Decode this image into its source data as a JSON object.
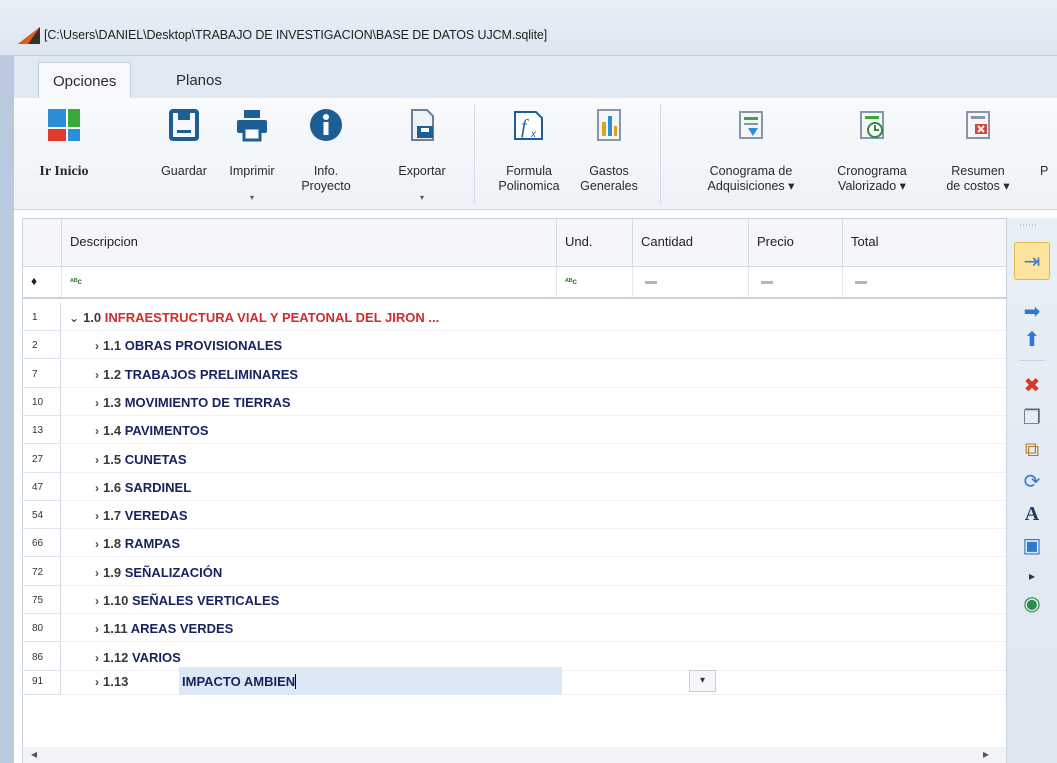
{
  "window": {
    "title": "[C:\\Users\\DANIEL\\Desktop\\TRABAJO DE INVESTIGACION\\BASE DE DATOS UJCM.sqlite]"
  },
  "ribbon_tabs": [
    {
      "label": "Opciones",
      "active": true
    },
    {
      "label": "Planos",
      "active": false
    }
  ],
  "ribbon": {
    "ir_inicio": "Ir Inicio",
    "guardar": "Guardar",
    "imprimir": "Imprimir",
    "info_line1": "Info.",
    "info_line2": "Proyecto",
    "exportar": "Exportar",
    "formula_line1": "Formula",
    "formula_line2": "Polinomica",
    "gastos_line1": "Gastos",
    "gastos_line2": "Generales",
    "conograma_line1": "Conograma de",
    "conograma_line2": "Adquisiciones ▾",
    "cronograma_line1": "Cronograma",
    "cronograma_line2": "Valorizado ▾",
    "resumen_line1": "Resumen",
    "resumen_line2": "de costos ▾",
    "cutoff": "P",
    "dropdown_glyph": "▾"
  },
  "grid": {
    "columns": [
      "Descripcion",
      "Und.",
      "Cantidad",
      "Precio",
      "Total"
    ],
    "filter_pin": "♦",
    "filter_text_glyph": "ᴬᴮc",
    "rows": [
      {
        "num": "1",
        "arrow": "⌄",
        "code": "1.0",
        "title": "INFRAESTRUCTURA VIAL Y PEATONAL DEL JIRON ..."
      },
      {
        "num": "2",
        "arrow": "›",
        "code": "1.1",
        "title": "OBRAS PROVISIONALES"
      },
      {
        "num": "7",
        "arrow": "›",
        "code": "1.2",
        "title": "TRABAJOS PRELIMINARES"
      },
      {
        "num": "10",
        "arrow": "›",
        "code": "1.3",
        "title": "MOVIMIENTO DE TIERRAS"
      },
      {
        "num": "13",
        "arrow": "›",
        "code": "1.4",
        "title": "PAVIMENTOS"
      },
      {
        "num": "27",
        "arrow": "›",
        "code": "1.5",
        "title": "CUNETAS"
      },
      {
        "num": "47",
        "arrow": "›",
        "code": "1.6",
        "title": "SARDINEL"
      },
      {
        "num": "54",
        "arrow": "›",
        "code": "1.7",
        "title": "VEREDAS"
      },
      {
        "num": "66",
        "arrow": "›",
        "code": "1.8",
        "title": "RAMPAS"
      },
      {
        "num": "72",
        "arrow": "›",
        "code": "1.9",
        "title": "SEÑALIZACIÓN"
      },
      {
        "num": "75",
        "arrow": "›",
        "code": "1.10",
        "title": "SEÑALES VERTICALES"
      },
      {
        "num": "80",
        "arrow": "›",
        "code": "1.11",
        "title": "AREAS VERDES"
      },
      {
        "num": "86",
        "arrow": "›",
        "code": "1.12",
        "title": "VARIOS"
      }
    ],
    "edit_row": {
      "num": "91",
      "arrow": "›",
      "code": "1.13",
      "value": "IMPACTO AMBIEN",
      "dropdown": "▾"
    },
    "scroll_left": "◂",
    "scroll_right": "▸"
  },
  "sidebar": {
    "grip": "⋯⋯",
    "icons": [
      "⇥",
      "➡",
      "⬆",
      "✖",
      "❐",
      "⧉",
      "⟳",
      "A",
      "▣",
      "▸",
      "◉"
    ]
  }
}
